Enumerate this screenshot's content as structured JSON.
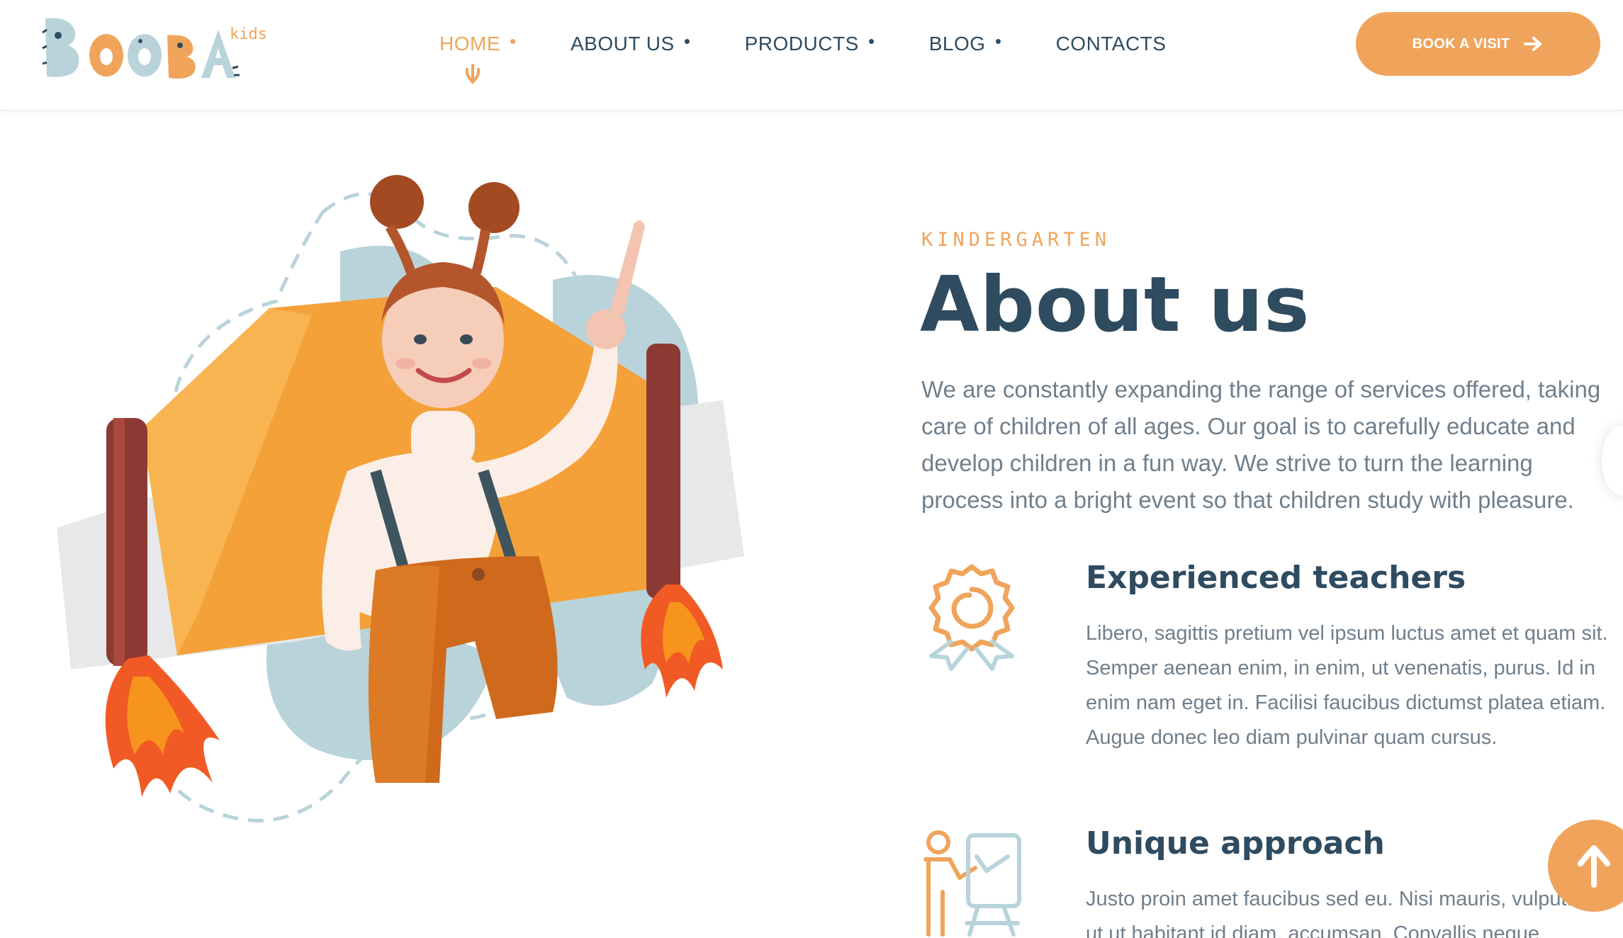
{
  "header": {
    "logo_text": "BOOBA",
    "logo_sub": "kids",
    "nav": [
      {
        "label": "HOME",
        "active": true
      },
      {
        "label": "ABOUT US",
        "active": false
      },
      {
        "label": "PRODUCTS",
        "active": false
      },
      {
        "label": "BLOG",
        "active": false
      },
      {
        "label": "CONTACTS",
        "active": false
      }
    ],
    "cta_label": "BOOK A VISIT",
    "cta_icon": "arrow-right-icon"
  },
  "about": {
    "eyebrow": "KINDERGARTEN",
    "title": "About us",
    "lead": "We are constantly expanding the range of services offered, taking care of children of all ages. Our goal is to carefully educate and develop children in a fun way. We strive to turn the learning process into a bright event so that children study with pleasure.",
    "features": [
      {
        "icon": "award-ribbon-icon",
        "title": "Experienced teachers",
        "text": "Libero, sagittis pretium vel ipsum luctus amet et quam sit. Semper aenean enim, in enim, ut venenatis, purus. Id in enim nam eget in. Facilisi faucibus dictumst platea etiam. Augue donec leo diam pulvinar quam cursus."
      },
      {
        "icon": "teacher-board-icon",
        "title": "Unique approach",
        "text": "Justo proin amet faucibus sed eu. Nisi mauris, vulputate ut ut habitant id diam, accumsan. Convallis neque"
      }
    ]
  },
  "colors": {
    "accent": "#f0a45b",
    "heading": "#2f4b60",
    "body_text": "#707f8c",
    "light_blue": "#b9d3da"
  },
  "scroll_top_icon": "arrow-up-icon"
}
